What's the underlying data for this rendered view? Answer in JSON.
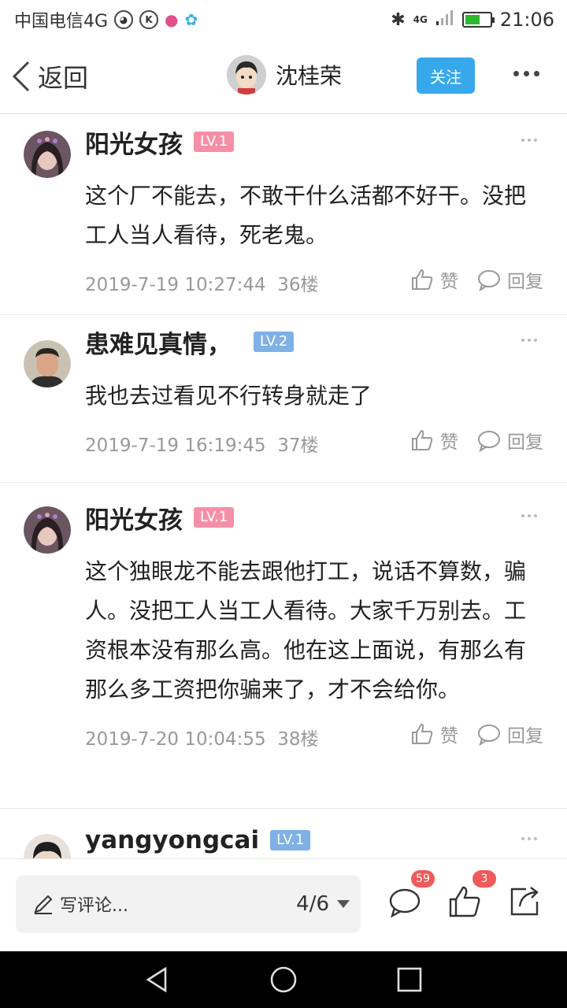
{
  "status_bar": {
    "carrier": "中国电信4G",
    "network": "4G",
    "time": "21:06",
    "battery_level": 0.6,
    "icons": [
      "penguin-icon",
      "k-icon",
      "cat-icon",
      "flower-icon",
      "bluetooth-icon",
      "signal-icon",
      "battery-icon"
    ]
  },
  "navbar": {
    "back_label": "返回",
    "author_name": "沈桂荣",
    "follow_label": "关注"
  },
  "comments": [
    {
      "name": "阳光女孩",
      "level": "LV.1",
      "level_color": "#f37f9b",
      "text": "这个厂不能去，不敢干什么活都不好干。没把工人当人看待，死老鬼。",
      "time": "2019-7-19 10:27:44",
      "floor": "36楼",
      "like_label": "赞",
      "reply_label": "回复"
    },
    {
      "name": "患难见真情，",
      "level": "LV.2",
      "level_color": "#7fb0e6",
      "text": "我也去过看见不行转身就走了",
      "time": "2019-7-19 16:19:45",
      "floor": "37楼",
      "like_label": "赞",
      "reply_label": "回复"
    },
    {
      "name": "阳光女孩",
      "level": "LV.1",
      "level_color": "#f37f9b",
      "text": "这个独眼龙不能去跟他打工，说话不算数，骗人。没把工人当工人看待。大家千万别去。工资根本没有那么高。他在这上面说，有那么有那么多工资把你骗来了，才不会给你。",
      "time": "2019-7-20 10:04:55",
      "floor": "38楼",
      "like_label": "赞",
      "reply_label": "回复"
    },
    {
      "name": "yangyongcai",
      "level": "LV.1",
      "level_color": "#7fb0e6",
      "text": "",
      "time": "",
      "floor": "",
      "like_label": "",
      "reply_label": ""
    }
  ],
  "bottom_bar": {
    "write_label": "写评论...",
    "page_indicator": "4/6",
    "comment_count": "59",
    "like_count": "3"
  },
  "colors": {
    "accent": "#38a8ec",
    "badge": "#f05a5a",
    "meta_text": "#999999"
  }
}
